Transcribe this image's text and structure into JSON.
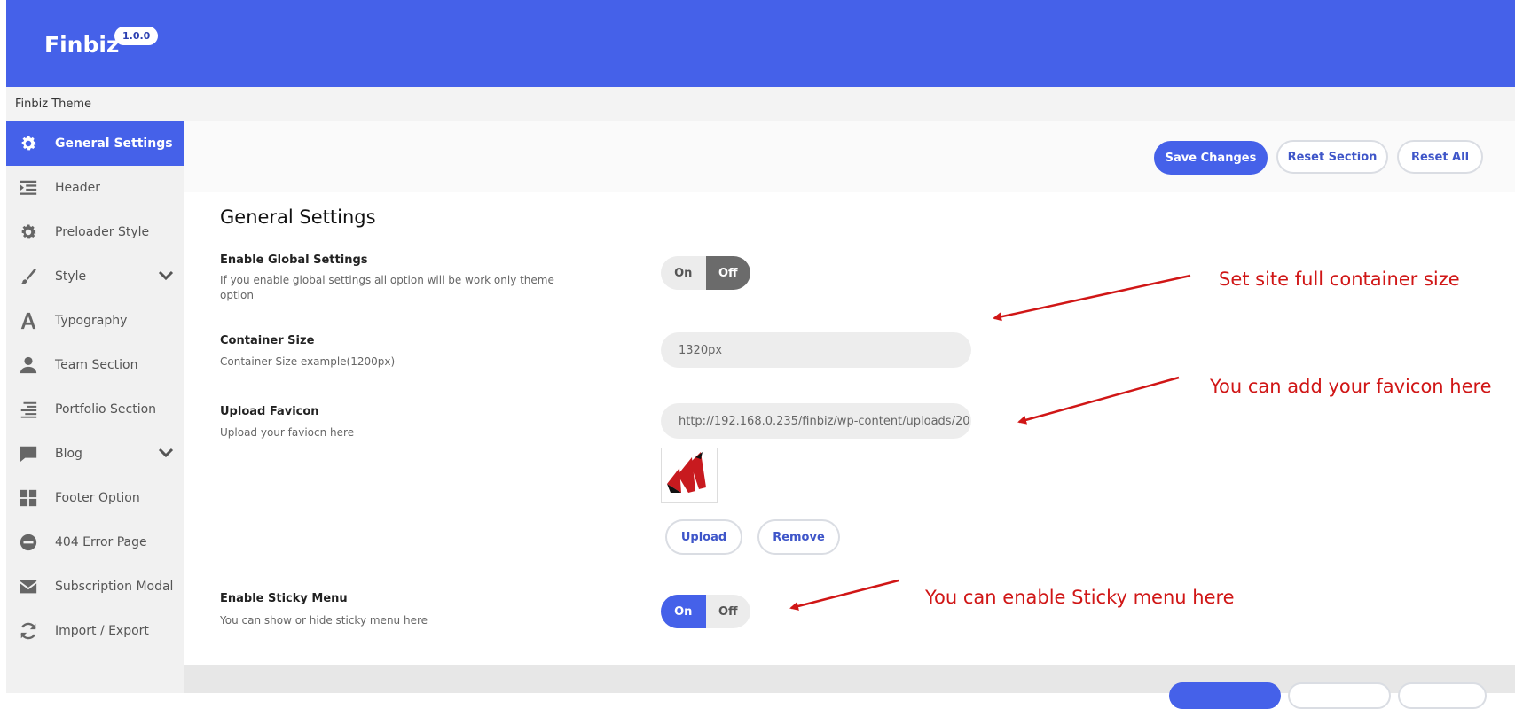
{
  "header": {
    "brand": "Finbiz",
    "version": "1.0.0",
    "subtitle": "Finbiz Theme",
    "bg_color": "#4561e9"
  },
  "sidebar": {
    "items": [
      {
        "label": "General Settings",
        "icon": "gear-icon",
        "active": true
      },
      {
        "label": "Header",
        "icon": "indent-icon"
      },
      {
        "label": "Preloader Style",
        "icon": "gear-icon"
      },
      {
        "label": "Style",
        "icon": "brush-icon",
        "has_children": true
      },
      {
        "label": "Typography",
        "icon": "font-icon"
      },
      {
        "label": "Team Section",
        "icon": "person-icon"
      },
      {
        "label": "Portfolio Section",
        "icon": "align-right-icon"
      },
      {
        "label": "Blog",
        "icon": "comment-icon",
        "has_children": true
      },
      {
        "label": "Footer Option",
        "icon": "grid-icon"
      },
      {
        "label": "404 Error Page",
        "icon": "minus-circle-icon"
      },
      {
        "label": "Subscription Modal",
        "icon": "envelope-icon"
      },
      {
        "label": "Import / Export",
        "icon": "refresh-icon"
      }
    ]
  },
  "actions": {
    "save": "Save Changes",
    "reset_section": "Reset Section",
    "reset_all": "Reset All"
  },
  "main": {
    "title": "General Settings",
    "fields": {
      "global": {
        "title": "Enable Global Settings",
        "desc": "If you enable global settings all option will be work only theme option",
        "on": "On",
        "off": "Off",
        "selected": "Off"
      },
      "container": {
        "title": "Container Size",
        "desc": "Container Size example(1200px)",
        "value": "1320px"
      },
      "favicon": {
        "title": "Upload Favicon",
        "desc": "Upload your faviocn here",
        "value": "http://192.168.0.235/finbiz/wp-content/uploads/20",
        "upload": "Upload",
        "remove": "Remove"
      },
      "sticky": {
        "title": "Enable Sticky Menu",
        "desc": "You can show or hide sticky menu here",
        "on": "On",
        "off": "Off",
        "selected": "On"
      }
    }
  },
  "annotations": {
    "container": "Set site full container size",
    "favicon": "You can add your favicon here",
    "sticky": "You can enable Sticky menu here",
    "color": "#d01616"
  }
}
